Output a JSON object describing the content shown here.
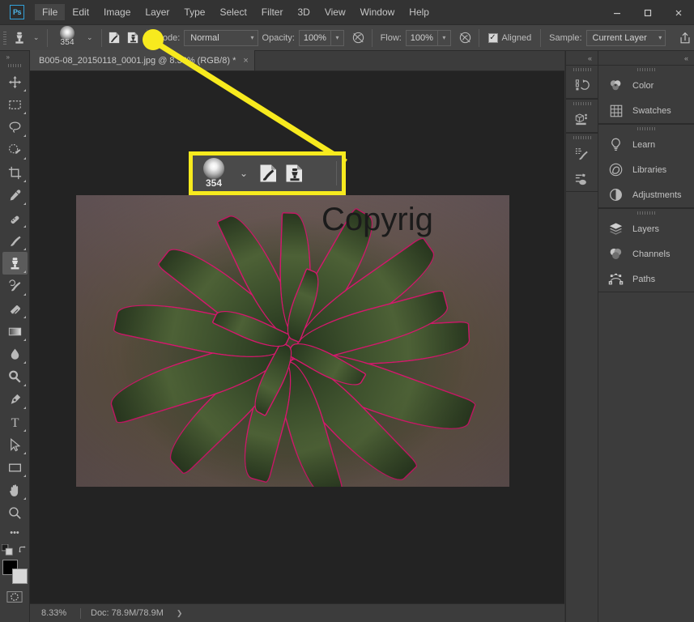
{
  "app": {
    "logo": "Ps"
  },
  "menubar": {
    "items": [
      {
        "label": "File"
      },
      {
        "label": "Edit"
      },
      {
        "label": "Image"
      },
      {
        "label": "Layer"
      },
      {
        "label": "Type"
      },
      {
        "label": "Select"
      },
      {
        "label": "Filter"
      },
      {
        "label": "3D"
      },
      {
        "label": "View"
      },
      {
        "label": "Window"
      },
      {
        "label": "Help"
      }
    ]
  },
  "window_controls": {
    "minimize": "—",
    "maximize": "❐",
    "close": "✕"
  },
  "options_bar": {
    "tool_icon": "clone-stamp-icon",
    "tool_preset_chevron": "⌄",
    "brush_size": "354",
    "brush_chevron": "⌄",
    "brush_settings_icon": "brush-settings-panel-icon",
    "clone_source_icon": "clone-source-panel-icon",
    "mode_label": "Mode:",
    "mode_value": "Normal",
    "opacity_label": "Opacity:",
    "opacity_value": "100%",
    "airbrush_icon": "airbrush-icon",
    "flow_label": "Flow:",
    "flow_value": "100%",
    "smoothing_icon": "smoothing-icon",
    "aligned_label": "Aligned",
    "aligned_checked": "✓",
    "sample_label": "Sample:",
    "sample_value": "Current Layer",
    "share_icon": "share-upload-icon"
  },
  "toolbar": {
    "expand_arrow": "»",
    "tools": [
      {
        "name": "move-tool",
        "glyph": "move"
      },
      {
        "name": "rectangular-marquee-tool",
        "glyph": "marquee"
      },
      {
        "name": "lasso-tool",
        "glyph": "lasso"
      },
      {
        "name": "quick-selection-tool",
        "glyph": "quickselect"
      },
      {
        "name": "crop-tool",
        "glyph": "crop"
      },
      {
        "name": "eyedropper-tool",
        "glyph": "eyedropper"
      },
      {
        "name": "spot-healing-brush-tool",
        "glyph": "healing"
      },
      {
        "name": "brush-tool",
        "glyph": "brush"
      },
      {
        "name": "clone-stamp-tool",
        "glyph": "stamp",
        "selected": true
      },
      {
        "name": "history-brush-tool",
        "glyph": "historybrush"
      },
      {
        "name": "eraser-tool",
        "glyph": "eraser"
      },
      {
        "name": "gradient-tool",
        "glyph": "gradient"
      },
      {
        "name": "blur-tool",
        "glyph": "blur"
      },
      {
        "name": "dodge-tool",
        "glyph": "dodge"
      },
      {
        "name": "pen-tool",
        "glyph": "pen"
      },
      {
        "name": "horizontal-type-tool",
        "glyph": "type"
      },
      {
        "name": "path-selection-tool",
        "glyph": "pathselect"
      },
      {
        "name": "rectangle-tool",
        "glyph": "rectangle"
      },
      {
        "name": "hand-tool",
        "glyph": "hand"
      },
      {
        "name": "zoom-tool",
        "glyph": "zoom"
      }
    ],
    "more_tools": "•••",
    "foreground_color": "#000000",
    "background_color": "#d8d8d8",
    "swap_icon": "swap-colors-icon",
    "default_colors_icon": "default-colors-icon",
    "quick_mask_icon": "quick-mask-icon"
  },
  "document": {
    "tab_title": "B005-08_20150118_0001.jpg @ 8.33% (RGB/8) *",
    "tab_close": "×",
    "image_overlay_text": "Copyriɡ"
  },
  "status_bar": {
    "zoom": "8.33%",
    "doc_info": "Doc: 78.9M/78.9M",
    "expand_arrow": "❯"
  },
  "panel_rail_icons": {
    "collapse_arrow": "«",
    "groups": [
      {
        "items": [
          {
            "name": "history-panel-icon"
          }
        ]
      },
      {
        "items": [
          {
            "name": "3d-panel-icon"
          }
        ]
      },
      {
        "items": [
          {
            "name": "brush-settings-icon"
          },
          {
            "name": "brushes-icon"
          }
        ]
      }
    ]
  },
  "panels": {
    "collapse_arrow": "«",
    "groups": [
      {
        "items": [
          {
            "label": "Color",
            "icon": "color-wheel-icon"
          },
          {
            "label": "Swatches",
            "icon": "swatches-grid-icon"
          }
        ]
      },
      {
        "items": [
          {
            "label": "Learn",
            "icon": "lightbulb-icon"
          },
          {
            "label": "Libraries",
            "icon": "libraries-icon"
          },
          {
            "label": "Adjustments",
            "icon": "adjustments-half-circle-icon"
          }
        ]
      },
      {
        "items": [
          {
            "label": "Layers",
            "icon": "layers-stack-icon"
          },
          {
            "label": "Channels",
            "icon": "channels-circles-icon"
          },
          {
            "label": "Paths",
            "icon": "paths-anchor-icon"
          }
        ]
      }
    ]
  },
  "annotation": {
    "highlight_color": "#f7ea1e",
    "callout": {
      "brush_size": "354",
      "chevron": "⌄",
      "brush_settings_icon": "brush-settings-panel-icon",
      "clone_source_icon": "clone-source-panel-icon"
    }
  }
}
